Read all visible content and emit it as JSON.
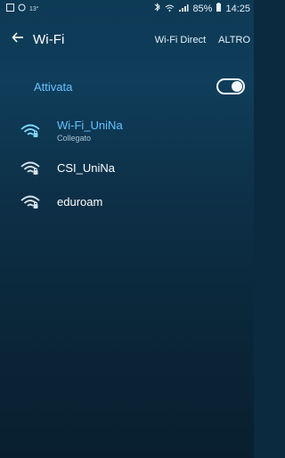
{
  "status_bar": {
    "left_text": "13°",
    "battery_percent": "85%",
    "time": "14:25"
  },
  "app_bar": {
    "title": "Wi-Fi",
    "wifi_direct": "Wi-Fi Direct",
    "more": "ALTRO"
  },
  "wifi_switch": {
    "label": "Attivata",
    "enabled": true
  },
  "networks": [
    {
      "name": "Wi-Fi_UniNa",
      "status": "Collegato"
    },
    {
      "name": "CSI_UniNa"
    },
    {
      "name": "eduroam"
    }
  ],
  "icons": {
    "back": "back-arrow-icon",
    "wifi": "wifi-lock-icon",
    "bluetooth": "bluetooth-icon",
    "status_left": "square-icon",
    "status_left_2": "circle-icon",
    "signal": "signal-icon",
    "battery": "battery-icon"
  },
  "colors": {
    "accent": "#65c2ff",
    "background_top": "#0d3a55",
    "background_bottom": "#091f2f",
    "text": "#ffffff",
    "subtext": "#a9c2d4"
  }
}
